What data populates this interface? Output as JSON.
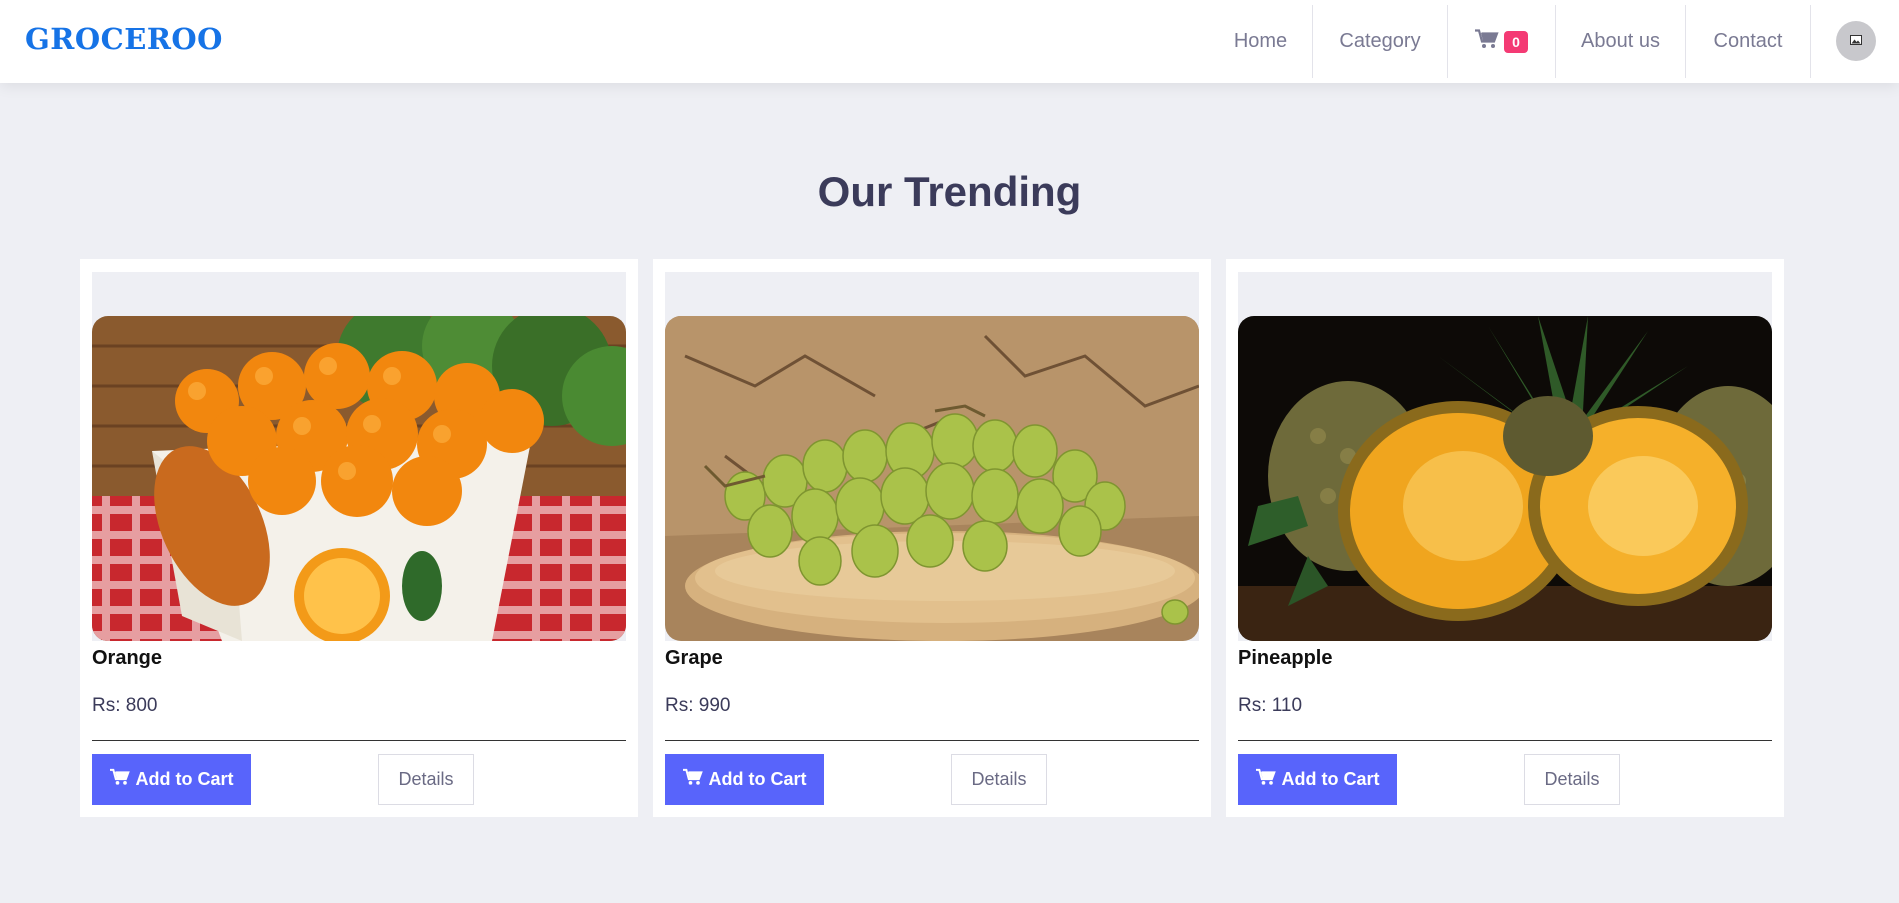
{
  "brand": {
    "name": "GROCEROO",
    "color": "#1673e6"
  },
  "nav": {
    "home": "Home",
    "category": "Category",
    "cart_icon": "cart-icon",
    "cart_count": "0",
    "about": "About us",
    "contact": "Contact",
    "avatar_icon": "avatar-image-icon"
  },
  "section": {
    "title": "Our Trending"
  },
  "products": [
    {
      "name": "Orange",
      "price": "Rs: 800",
      "add_label": "Add to Cart",
      "details_label": "Details",
      "image": "orange-basket-image"
    },
    {
      "name": "Grape",
      "price": "Rs: 990",
      "add_label": "Add to Cart",
      "details_label": "Details",
      "image": "grapes-image"
    },
    {
      "name": "Pineapple",
      "price": "Rs: 110",
      "add_label": "Add to Cart",
      "details_label": "Details",
      "image": "pineapple-image"
    }
  ],
  "colors": {
    "accent_button": "#5864fb",
    "badge": "#f43a74",
    "background": "#eeeff4",
    "heading": "#3b3b5a"
  }
}
